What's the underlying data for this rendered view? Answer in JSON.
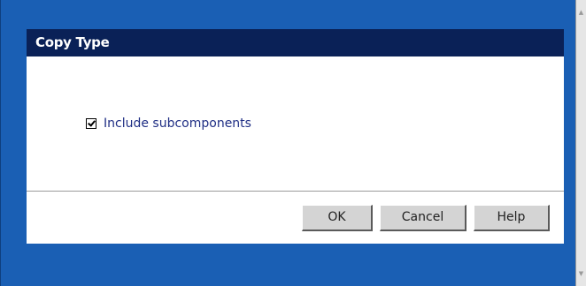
{
  "dialog": {
    "title": "Copy Type",
    "checkbox": {
      "label": "Include subcomponents",
      "checked": true
    },
    "buttons": {
      "ok": "OK",
      "cancel": "Cancel",
      "help": "Help"
    }
  },
  "colors": {
    "backdrop": "#1A5FB4",
    "titlebar": "#0A2157",
    "label_text": "#1F2E84",
    "button_face": "#D4D4D4"
  },
  "icons": {
    "scroll_up": "scroll-up-arrow",
    "scroll_down": "scroll-down-arrow"
  }
}
